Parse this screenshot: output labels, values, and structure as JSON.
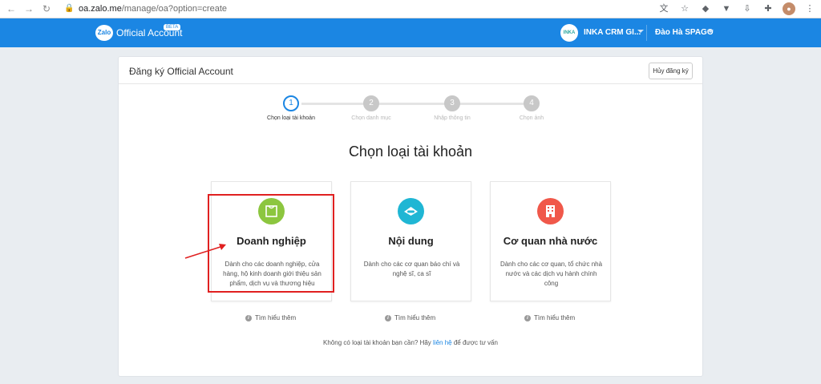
{
  "browser": {
    "url_host": "oa.zalo.me",
    "url_path": "/manage/oa?option=create"
  },
  "header": {
    "logo_text": "Zalo",
    "product": "Official Account",
    "beta": "BETA",
    "account_avatar": "INKA",
    "account_name": "INKA CRM GI...",
    "user_name": "Đào Hà SPAGO"
  },
  "card": {
    "title": "Đăng ký Official Account",
    "cancel_label": "Hủy đăng ký",
    "heading": "Chọn loại tài khoản"
  },
  "steps": [
    {
      "number": "1",
      "label": "Chọn loại tài khoản",
      "active": true
    },
    {
      "number": "2",
      "label": "Chọn danh mục",
      "active": false
    },
    {
      "number": "3",
      "label": "Nhập thông tin",
      "active": false
    },
    {
      "number": "4",
      "label": "Chọn ảnh",
      "active": false
    }
  ],
  "options": [
    {
      "title": "Doanh nghiệp",
      "description": "Dành cho các doanh nghiệp, cửa hàng, hộ kinh doanh giới thiệu sản phẩm, dịch vụ và thương hiệu",
      "icon": "shopping-bag-icon",
      "color": "#8cc63f",
      "learn_more": "Tìm hiểu thêm"
    },
    {
      "title": "Nội dung",
      "description": "Dành cho các cơ quan báo chí và nghệ sĩ, ca sĩ",
      "icon": "content-icon",
      "color": "#1fb6d4",
      "learn_more": "Tìm hiểu thêm"
    },
    {
      "title": "Cơ quan nhà nước",
      "description": "Dành cho các cơ quan, tổ chức nhà nước và các dịch vụ hành chính công",
      "icon": "building-icon",
      "color": "#f0584a",
      "learn_more": "Tìm hiểu thêm"
    }
  ],
  "footer": {
    "prefix": "Không có loại tài khoản bạn cần? Hãy",
    "link": "liên hệ",
    "suffix": "để được tư vấn"
  },
  "colors": {
    "brand": "#1b86e3",
    "highlight": "#e02020"
  }
}
